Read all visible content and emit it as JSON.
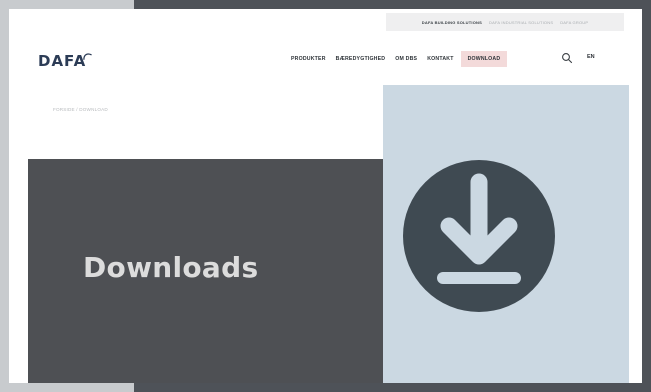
{
  "topbar": {
    "links": [
      "DAFA BUILDING SOLUTIONS",
      "DAFA INDUSTRIAL SOLUTIONS",
      "DAFA GROUP"
    ]
  },
  "header": {
    "logo_text": "DAFA",
    "nav": [
      "PRODUKTER",
      "BÆREDYGTIGHED",
      "OM DBS",
      "KONTAKT",
      "DOWNLOAD"
    ],
    "language": "EN"
  },
  "breadcrumb": {
    "text": "FORSIDE / DOWNLOAD"
  },
  "hero": {
    "title": "Downloads"
  },
  "colors": {
    "accent_pink": "#f3dada",
    "hero_dark": "#4e5054",
    "hero_light": "#cbd8e2",
    "icon_circle": "#3f4a52",
    "icon_arrow": "#cbd8e2",
    "logo_blue": "#2c3c56"
  },
  "icons": {
    "search": "search-icon",
    "download": "download-icon",
    "logo_swoosh": "logo-swoosh-icon"
  }
}
